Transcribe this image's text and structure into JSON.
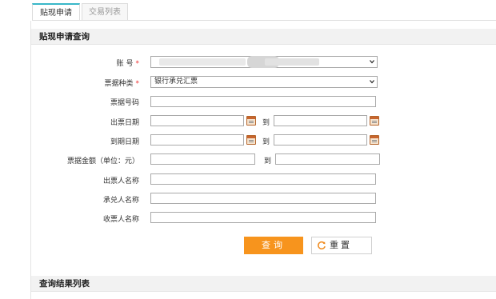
{
  "tabs": [
    {
      "label": "贴现申请",
      "active": true
    },
    {
      "label": "交易列表",
      "active": false
    }
  ],
  "query_section": {
    "title": "贴现申请查询"
  },
  "form": {
    "account": {
      "label": "账 号",
      "required_mark": "*"
    },
    "bill_type": {
      "label": "票据种类",
      "required_mark": "*",
      "selected": "银行承兑汇票"
    },
    "bill_number": {
      "label": "票据号码",
      "value": ""
    },
    "issue_date": {
      "label": "出票日期",
      "from": "",
      "to": ""
    },
    "due_date": {
      "label": "到期日期",
      "from": "",
      "to": ""
    },
    "amount": {
      "label": "票据金额（单位：元）",
      "from": "",
      "to": ""
    },
    "range_separator": "到",
    "drawer_name": {
      "label": "出票人名称",
      "value": ""
    },
    "acceptor_name": {
      "label": "承兑人名称",
      "value": ""
    },
    "payee_name": {
      "label": "收票人名称",
      "value": ""
    }
  },
  "buttons": {
    "query": "查询",
    "reset": "重置"
  },
  "results_section": {
    "title": "查询结果列表"
  },
  "icons": {
    "calendar": "calendar-icon",
    "dropdown": "chevron-down-icon",
    "reset": "refresh-icon"
  },
  "colors": {
    "tab_active_accent": "#39b7c8",
    "required": "#ee3333",
    "query_button": "#f7941d"
  }
}
